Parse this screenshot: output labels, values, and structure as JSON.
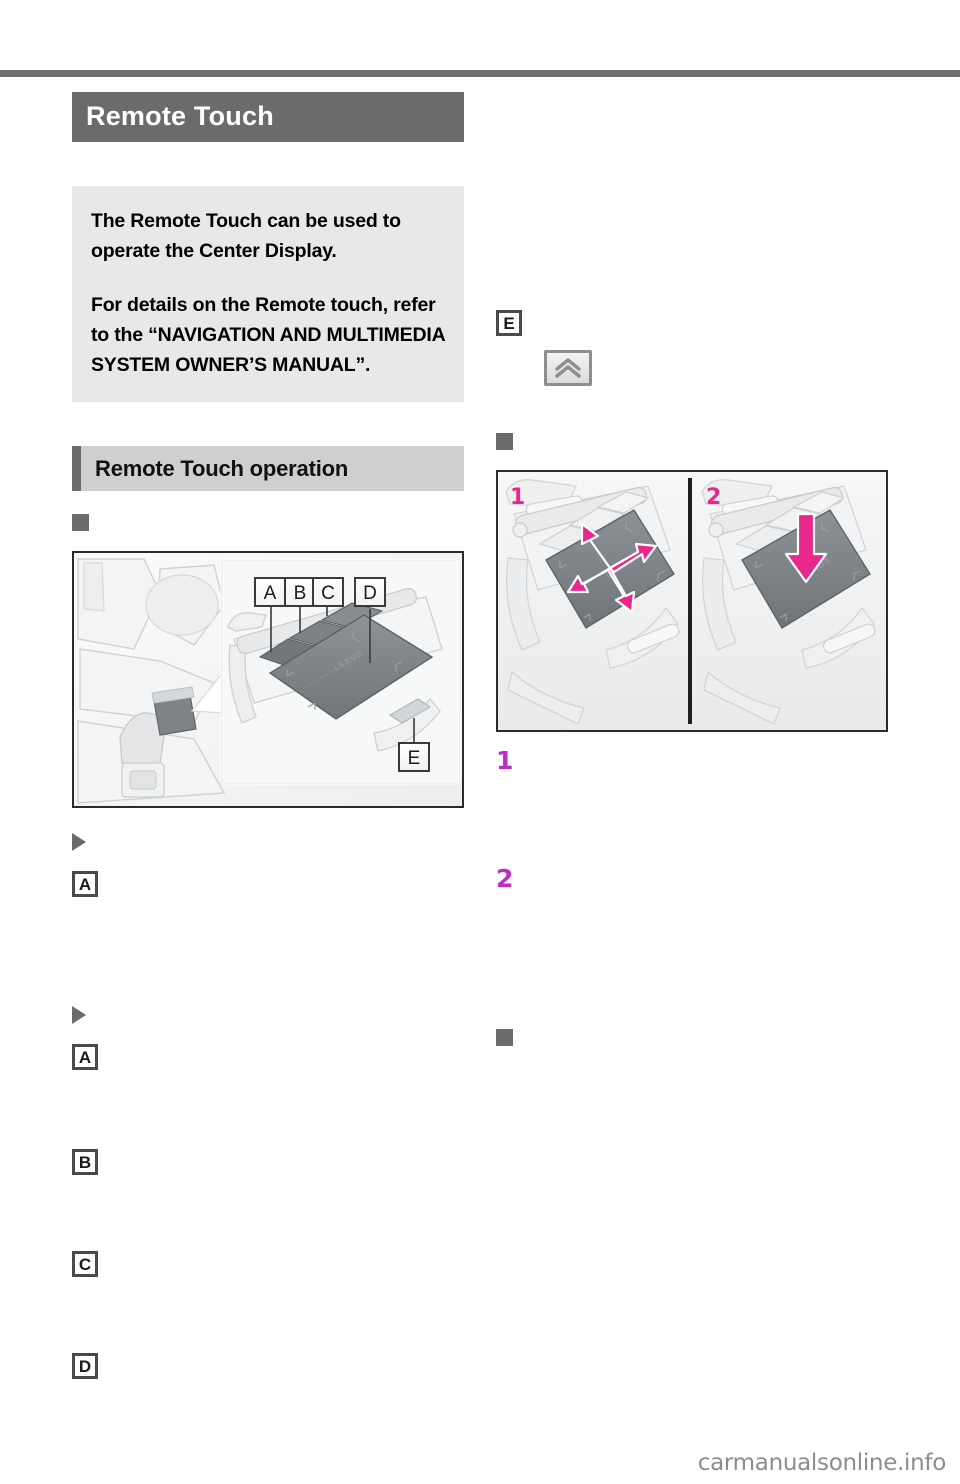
{
  "document": {
    "running_head": "",
    "watermark": "carmanualsonline.info"
  },
  "section": {
    "title": "Remote Touch"
  },
  "intro": {
    "paragraph_1": "The Remote Touch can be used to operate the Center Display.",
    "paragraph_2": "For details on the Remote touch, refer to the “NAVIGATION AND MULTIMEDIA SYSTEM OWNER’S MANUAL”."
  },
  "subsection": {
    "label": "Remote Touch operation"
  },
  "left_column": {
    "heading_components": "",
    "figure_console": {
      "caption": "",
      "callouts": [
        "A",
        "B",
        "C",
        "D",
        "E"
      ]
    },
    "group_1": {
      "triangle_heading": "",
      "items": [
        {
          "letter": "A",
          "text": ""
        }
      ]
    },
    "group_2": {
      "triangle_heading": "",
      "items": [
        {
          "letter": "A",
          "text": ""
        },
        {
          "letter": "B",
          "text": ""
        },
        {
          "letter": "C",
          "text": ""
        },
        {
          "letter": "D",
          "text": ""
        }
      ]
    }
  },
  "right_column": {
    "items": [
      {
        "letter": "E",
        "text": ""
      }
    ],
    "chevron_button": {
      "icon": "double-chevron-up-icon",
      "trailing_text": ""
    },
    "heading_gestures": "",
    "figure_gestures": {
      "panels": [
        {
          "number": "1",
          "gesture": "four-way-arrows"
        },
        {
          "number": "2",
          "gesture": "press-down-arrow"
        }
      ]
    },
    "steps": [
      {
        "number": "1",
        "text": ""
      },
      {
        "number": "2",
        "text": ""
      }
    ],
    "heading_trailing": ""
  },
  "colors": {
    "section_bar": "#6b6b6b",
    "subsection_bar": "#cfcfcf",
    "intro_box": "#e8e8e8",
    "accent_magenta": "#c02bc8",
    "arrow_magenta": "#e8288c",
    "rule": "#6e6e6e"
  }
}
